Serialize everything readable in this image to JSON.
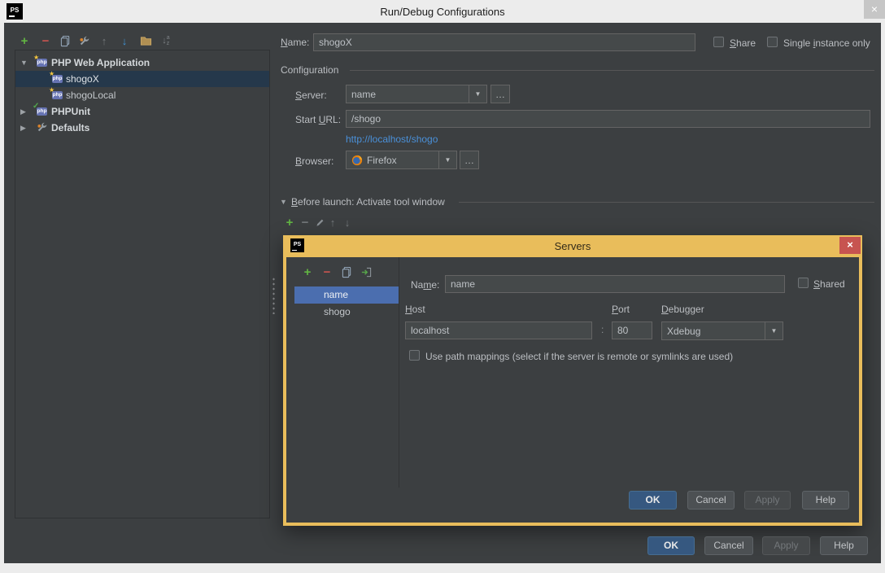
{
  "window": {
    "title": "Run/Debug Configurations",
    "logo_text": "PS",
    "close_glyph": "×"
  },
  "glyphs": {
    "add": "+",
    "remove": "−",
    "move_up": "↑",
    "move_down": "↓",
    "dropdown": "▼",
    "expanded": "▼",
    "collapsed": "▶",
    "more": "…",
    "php_badge": "php",
    "star": "★",
    "check": "✓",
    "sort_a": "a",
    "sort_z": "z"
  },
  "colors": {
    "background": "#3c3f41",
    "window_frame": "#ececec",
    "selection_focused": "#4b6eaf",
    "selection_unfocused": "#25384b",
    "dialog_border": "#e9bd5b",
    "dialog_close_button": "#c75450",
    "link": "#4a90d9",
    "primary_button": "#365880",
    "add_icon": "#62b543",
    "remove_icon": "#c75450"
  },
  "sidebar": {
    "items": [
      {
        "label": "PHP Web Application",
        "bold": true,
        "state": "expanded"
      },
      {
        "label": "shogoX",
        "selected": true
      },
      {
        "label": "shogoLocal"
      },
      {
        "label": "PHPUnit",
        "bold": true,
        "state": "collapsed"
      },
      {
        "label": "Defaults",
        "bold": true,
        "state": "collapsed"
      }
    ]
  },
  "form": {
    "name_label": "Name:",
    "name_value": "shogoX",
    "share_label": "Share",
    "single_instance_label": "Single instance only",
    "section_title": "Configuration",
    "server_label": "Server:",
    "server_value": "name",
    "start_url_label": "Start URL:",
    "start_url_value": "/shogo",
    "url_preview": "http://localhost/shogo",
    "browser_label": "Browser:",
    "browser_value": "Firefox",
    "before_launch_label": "Before launch: Activate tool window"
  },
  "servers_dialog": {
    "title": "Servers",
    "logo_text": "PS",
    "list": [
      {
        "label": "name",
        "selected": true
      },
      {
        "label": "shogo"
      }
    ],
    "name_label": "Name:",
    "name_value": "name",
    "shared_label": "Shared",
    "host_label": "Host",
    "host_value": "localhost",
    "port_separator": ":",
    "port_label": "Port",
    "port_value": "80",
    "debugger_label": "Debugger",
    "debugger_value": "Xdebug",
    "path_mappings_label": "Use path mappings (select if the server is remote or symlinks are used)",
    "buttons": {
      "ok": "OK",
      "cancel": "Cancel",
      "apply": "Apply",
      "help": "Help"
    }
  },
  "footer_buttons": {
    "ok": "OK",
    "cancel": "Cancel",
    "apply": "Apply",
    "help": "Help"
  }
}
